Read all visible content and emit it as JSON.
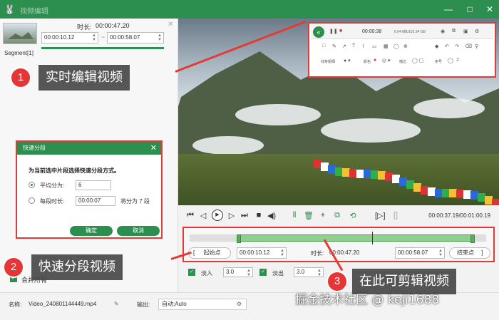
{
  "titlebar": {
    "title": "视频编辑",
    "minimize": "—",
    "maximize": "□",
    "close": "✕"
  },
  "segment": {
    "label": "Segment[1]",
    "duration_label": "时长:",
    "duration": "00:00:47.20",
    "start": "00:00:10.12",
    "separator": "~",
    "end": "00:00:58.07"
  },
  "callouts": [
    {
      "num": "1",
      "text": "实时编辑视频"
    },
    {
      "num": "2",
      "text": "快速分段视频"
    },
    {
      "num": "3",
      "text": "在此可剪辑视频"
    }
  ],
  "dialog": {
    "title": "快速分段",
    "prompt": "为当前选中片段选择快速分段方式。",
    "opt1_label": "平均分为:",
    "opt1_value": "6",
    "opt2_label": "每段时长:",
    "opt2_value": "00:00:07",
    "opt2_hint": "将分为 7 段",
    "ok": "确定",
    "cancel": "取消"
  },
  "merge": {
    "label": "合并所有"
  },
  "toolbar_img": {
    "time": "00:00:38",
    "size": "6.94 MB/102.34 GB",
    "line_label": "线条粗细",
    "color_label": "颜色",
    "stroke_label": "描边",
    "num_label": "序号",
    "num_value": "2"
  },
  "player": {
    "time": "00:00:37.19/00:01:00.19"
  },
  "trim": {
    "start_btn": "起始点",
    "start": "00:00:10.12",
    "duration_label": "时长:",
    "duration": "00:00:47.20",
    "end": "00:00:58.07",
    "end_btn": "结束点"
  },
  "fade": {
    "in_label": "淡入",
    "in_value": "3.0",
    "out_label": "淡出",
    "out_value": "3.0"
  },
  "bottom": {
    "name_label": "名称:",
    "name": "Video_240801144449.mp4",
    "output_label": "输出:",
    "output": "自动;Auto"
  },
  "watermark": "掘金技术社区 @ keji1688",
  "colors": {
    "accent": "#2d8f4f",
    "highlight": "#e53935"
  }
}
